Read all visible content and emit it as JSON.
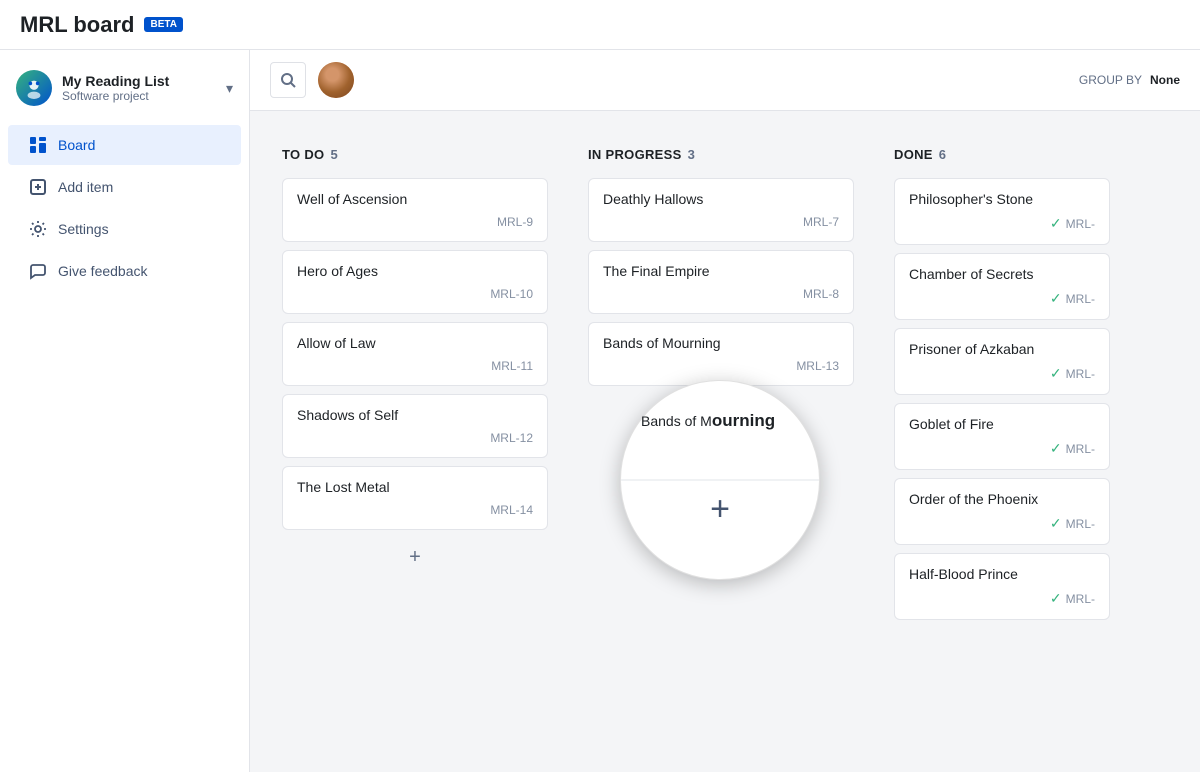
{
  "header": {
    "title": "MRL board",
    "beta_label": "BETA"
  },
  "sidebar": {
    "project_name": "My Reading List",
    "project_sub": "Software project",
    "items": [
      {
        "id": "board",
        "label": "Board",
        "active": true
      },
      {
        "id": "add-item",
        "label": "Add item",
        "active": false
      },
      {
        "id": "settings",
        "label": "Settings",
        "active": false
      },
      {
        "id": "give-feedback",
        "label": "Give feedback",
        "active": false
      }
    ]
  },
  "toolbar": {
    "search_placeholder": "Search",
    "group_by_label": "GROUP BY",
    "group_by_value": "None"
  },
  "board": {
    "columns": [
      {
        "id": "todo",
        "title": "TO DO",
        "count": 5,
        "cards": [
          {
            "title": "Well of Ascension",
            "id": "MRL-9",
            "done": false
          },
          {
            "title": "Hero of Ages",
            "id": "MRL-10",
            "done": false
          },
          {
            "title": "Allow of Law",
            "id": "MRL-11",
            "done": false
          },
          {
            "title": "Shadows of Self",
            "id": "MRL-12",
            "done": false
          },
          {
            "title": "The Lost Metal",
            "id": "MRL-14",
            "done": false
          }
        ]
      },
      {
        "id": "inprogress",
        "title": "IN PROGRESS",
        "count": 3,
        "cards": [
          {
            "title": "Deathly Hallows",
            "id": "MRL-7",
            "done": false
          },
          {
            "title": "The Final Empire",
            "id": "MRL-8",
            "done": false
          },
          {
            "title": "Bands of Mourning",
            "id": "MRL-13",
            "done": false
          }
        ]
      },
      {
        "id": "done",
        "title": "DONE",
        "count": 6,
        "cards": [
          {
            "title": "Philosopher's Stone",
            "id": "MRL-",
            "done": true
          },
          {
            "title": "Chamber of Secrets",
            "id": "MRL-",
            "done": true
          },
          {
            "title": "Prisoner of Azkaban",
            "id": "MRL-",
            "done": true
          },
          {
            "title": "Goblet of Fire",
            "id": "MRL-",
            "done": true
          },
          {
            "title": "Order of the Phoenix",
            "id": "MRL-",
            "done": true
          },
          {
            "title": "Half-Blood Prince",
            "id": "MRL-",
            "done": true
          }
        ]
      }
    ]
  },
  "icons": {
    "board": "⊞",
    "add": "⊕",
    "settings": "⚙",
    "feedback": "📢",
    "search": "🔍",
    "chevron": "▾",
    "plus": "+",
    "check": "✓"
  }
}
